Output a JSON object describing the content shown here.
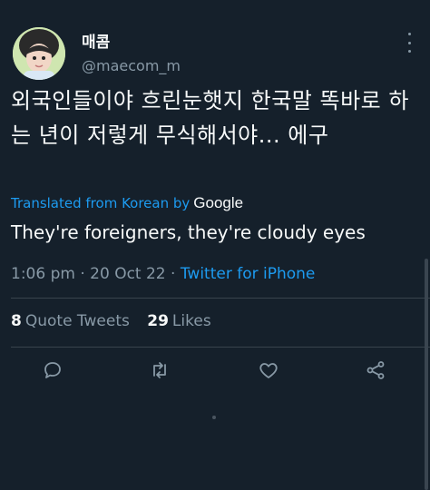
{
  "colors": {
    "background": "#15202b",
    "accent": "#1d9bf0",
    "muted": "#8899a6",
    "text": "#f7f9f9"
  },
  "author": {
    "display_name": "매콤",
    "handle": "@maecom_m"
  },
  "tweet": {
    "text": "외국인들이야 흐린눈햇지 한국말 똑바로 하는 년이 저렇게 무식해서야... 에구",
    "translated_label": "Translated from Korean by",
    "translator": "Google",
    "translation": "They're foreigners, they're cloudy eyes",
    "time": "1:06 pm",
    "date": "20 Oct 22",
    "separator": "·",
    "source": "Twitter for iPhone"
  },
  "stats": {
    "quote_count": "8",
    "quote_label": "Quote Tweets",
    "like_count": "29",
    "like_label": "Likes"
  },
  "actions": [
    "reply-icon",
    "retweet-icon",
    "like-icon",
    "share-icon"
  ]
}
